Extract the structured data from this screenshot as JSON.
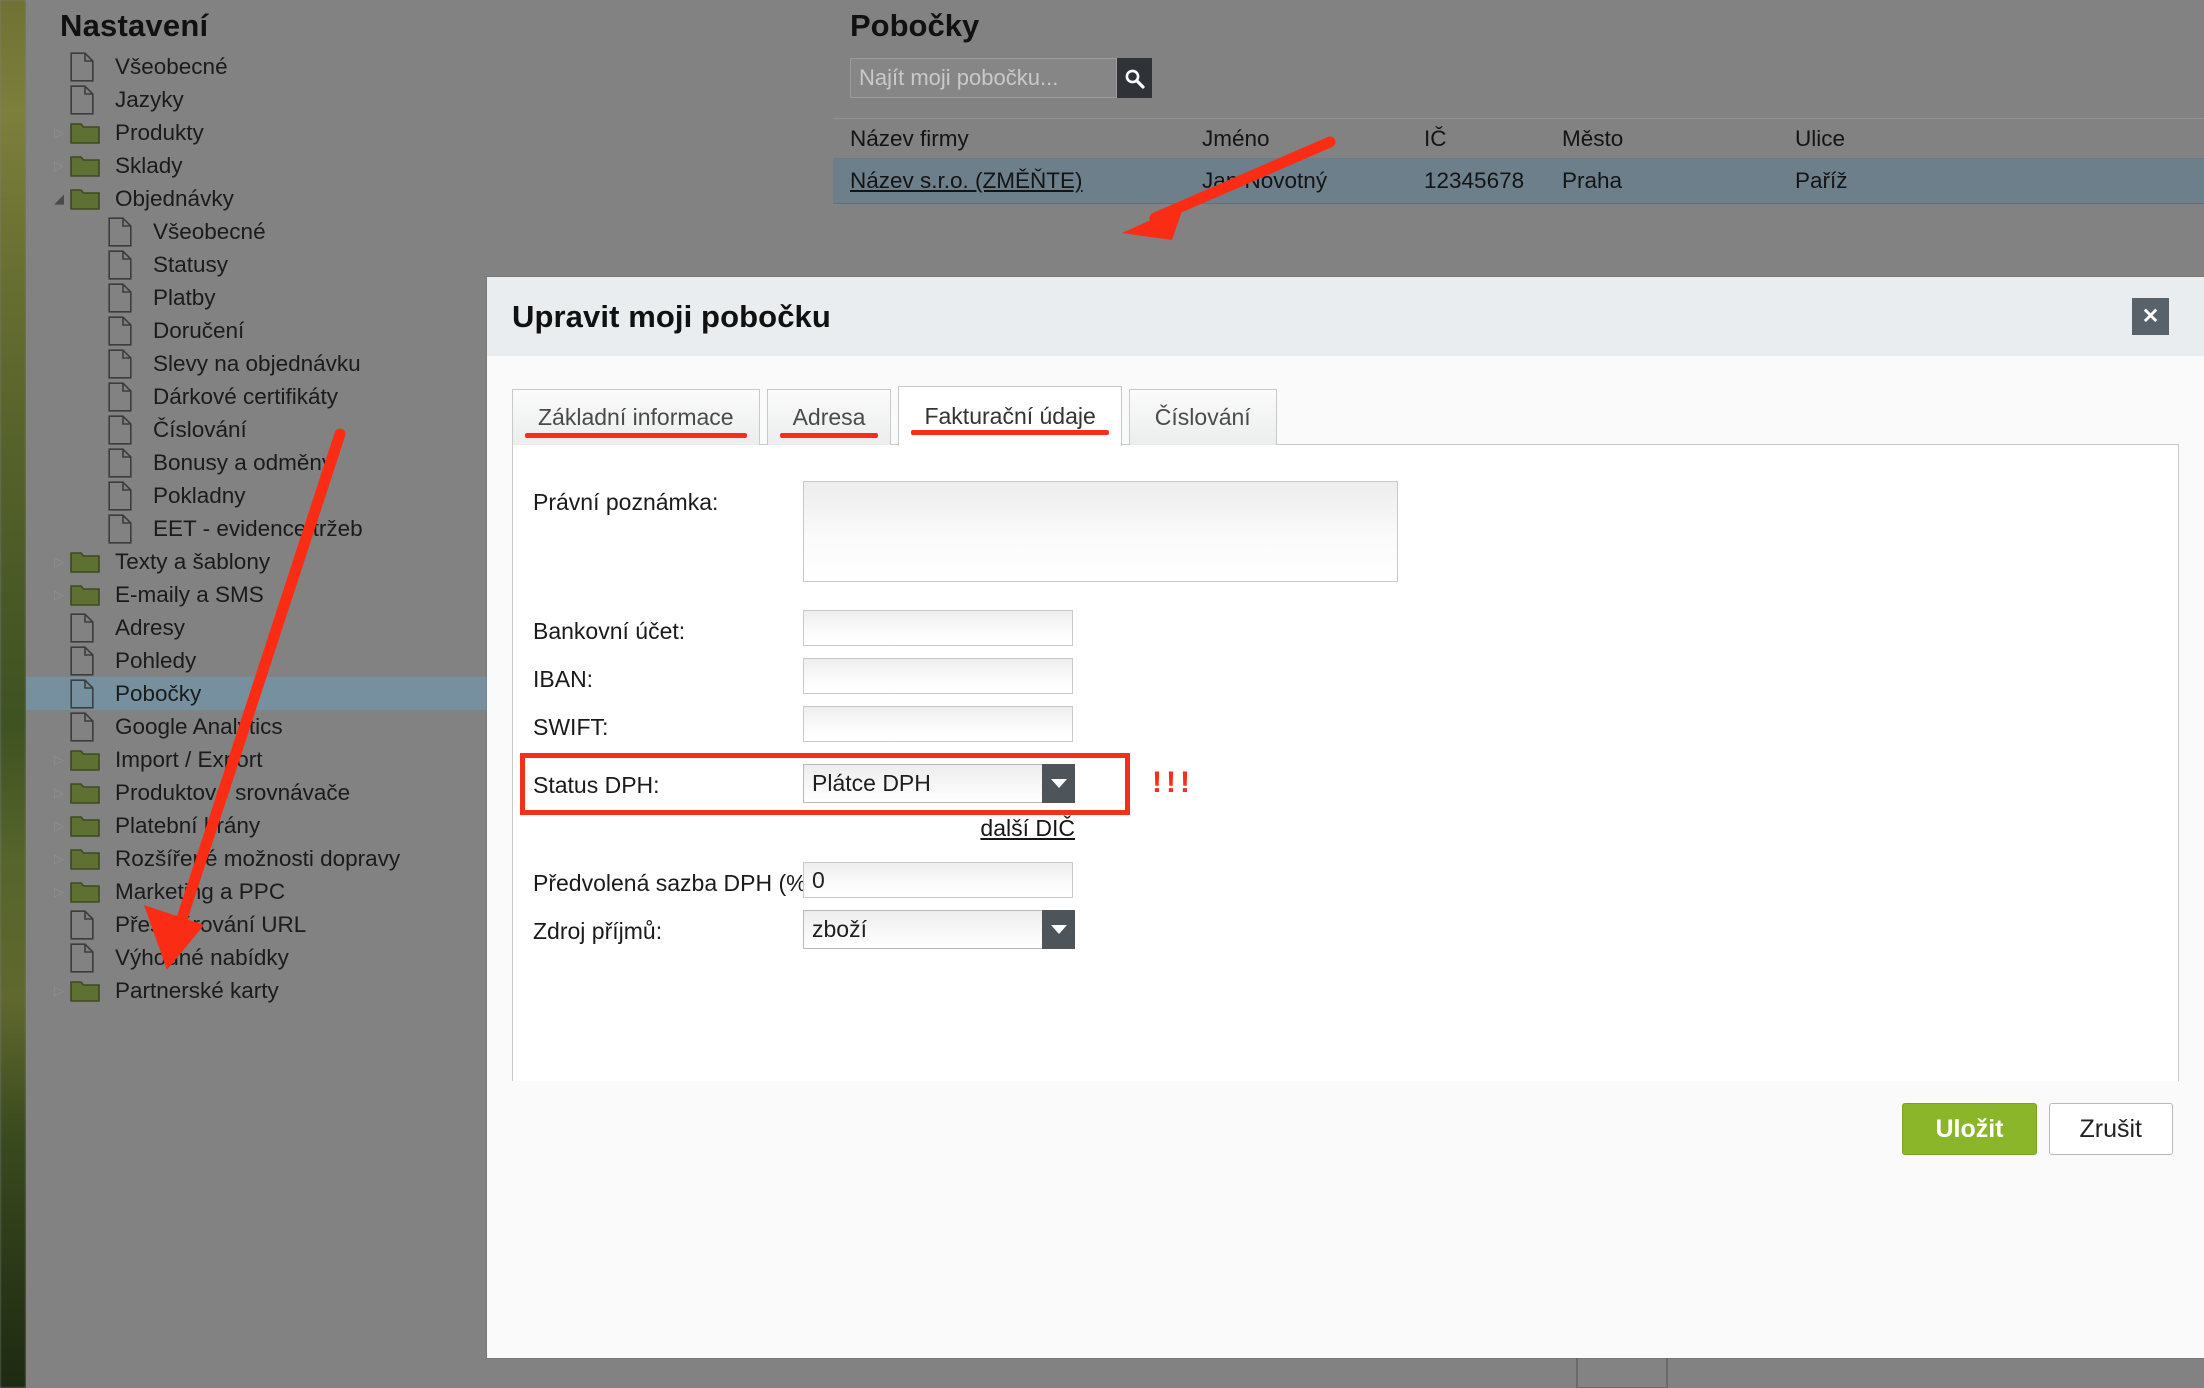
{
  "sidebar": {
    "title": "Nastavení",
    "items": [
      {
        "label": "Všeobecné",
        "type": "file",
        "level": 1
      },
      {
        "label": "Jazyky",
        "type": "file",
        "level": 1
      },
      {
        "label": "Produkty",
        "type": "folder",
        "level": 1,
        "twisty": "collapsed"
      },
      {
        "label": "Sklady",
        "type": "folder",
        "level": 1,
        "twisty": "collapsed"
      },
      {
        "label": "Objednávky",
        "type": "folder",
        "level": 1,
        "twisty": "expanded"
      },
      {
        "label": "Všeobecné",
        "type": "file",
        "level": 2
      },
      {
        "label": "Statusy",
        "type": "file",
        "level": 2
      },
      {
        "label": "Platby",
        "type": "file",
        "level": 2
      },
      {
        "label": "Doručení",
        "type": "file",
        "level": 2
      },
      {
        "label": "Slevy na objednávku",
        "type": "file",
        "level": 2
      },
      {
        "label": "Dárkové certifikáty",
        "type": "file",
        "level": 2
      },
      {
        "label": "Číslování",
        "type": "file",
        "level": 2
      },
      {
        "label": "Bonusy a odměny",
        "type": "file",
        "level": 2
      },
      {
        "label": "Pokladny",
        "type": "file",
        "level": 2
      },
      {
        "label": "EET - evidence tržeb",
        "type": "file",
        "level": 2
      },
      {
        "label": "Texty a šablony",
        "type": "folder",
        "level": 1,
        "twisty": "collapsed"
      },
      {
        "label": "E-maily a SMS",
        "type": "folder",
        "level": 1,
        "twisty": "collapsed"
      },
      {
        "label": "Adresy",
        "type": "file",
        "level": 1
      },
      {
        "label": "Pohledy",
        "type": "file",
        "level": 1
      },
      {
        "label": "Pobočky",
        "type": "file",
        "level": 1,
        "selected": true
      },
      {
        "label": "Google Analytics",
        "type": "file",
        "level": 1
      },
      {
        "label": "Import / Export",
        "type": "folder",
        "level": 1,
        "twisty": "collapsed"
      },
      {
        "label": "Produktové srovnávače",
        "type": "folder",
        "level": 1,
        "twisty": "collapsed"
      },
      {
        "label": "Platební brány",
        "type": "folder",
        "level": 1,
        "twisty": "collapsed"
      },
      {
        "label": "Rozšířené možnosti dopravy",
        "type": "folder",
        "level": 1,
        "twisty": "collapsed"
      },
      {
        "label": "Marketing a PPC",
        "type": "folder",
        "level": 1,
        "twisty": "collapsed"
      },
      {
        "label": "Přesměrování URL",
        "type": "file",
        "level": 1
      },
      {
        "label": "Výhodné nabídky",
        "type": "file",
        "level": 1
      },
      {
        "label": "Partnerské karty",
        "type": "folder",
        "level": 1,
        "twisty": "collapsed"
      }
    ]
  },
  "content": {
    "title": "Pobočky",
    "search": {
      "placeholder": "Najít moji pobočku...",
      "value": "",
      "icon": "search-icon"
    },
    "table": {
      "columns": [
        "Název firmy",
        "Jméno",
        "IČ",
        "Město",
        "Ulice"
      ],
      "rows": [
        {
          "nazev_firmy": "Název s.r.o. (ZMĚŇTE)",
          "jmeno": "Jan Novotný",
          "ic": "12345678",
          "mesto": "Praha",
          "ulice": "Paříž"
        }
      ]
    }
  },
  "modal": {
    "title": "Upravit moji pobočku",
    "close_label": "✕",
    "close_icon": "close-icon",
    "tabs": [
      {
        "label": "Základní informace",
        "active": false,
        "underlined": true
      },
      {
        "label": "Adresa",
        "active": false,
        "underlined": true
      },
      {
        "label": "Fakturační údaje",
        "active": true,
        "underlined": true
      },
      {
        "label": "Číslování",
        "active": false,
        "underlined": false
      }
    ],
    "fields": {
      "legal_note_label": "Právní poznámka:",
      "legal_note_value": "",
      "bank_account_label": "Bankovní účet:",
      "bank_account_value": "",
      "iban_label": "IBAN:",
      "iban_value": "",
      "swift_label": "SWIFT:",
      "swift_value": "",
      "vat_status_label": "Status DPH:",
      "vat_status_value": "Plátce DPH",
      "another_vat_link": "další DIČ",
      "default_vat_rate_label": "Předvolená sazba DPH (%):",
      "default_vat_rate_value": "0",
      "income_source_label": "Zdroj příjmů:",
      "income_source_value": "zboží"
    },
    "annotation": "!!!",
    "buttons": {
      "save": "Uložit",
      "cancel": "Zrušit"
    }
  },
  "colors": {
    "accent_red": "#f4301b",
    "save_green": "#8cb629",
    "selected_row": "#6d7f8b",
    "sidebar_bg": "#828282"
  }
}
